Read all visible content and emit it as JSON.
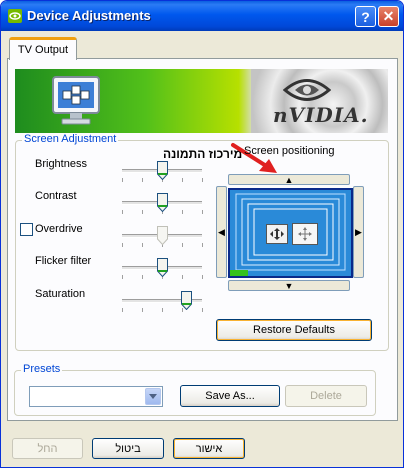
{
  "window": {
    "title": "Device Adjustments",
    "help_button": "?",
    "close_button": "✕"
  },
  "tabs": [
    {
      "label": "TV Output",
      "selected": true
    }
  ],
  "banner": {
    "brand_text": "nVIDIA."
  },
  "screen_adjustment": {
    "group_label": "Screen Adjustment",
    "sliders": [
      {
        "label": "Brightness",
        "level": 0.5,
        "enabled": true
      },
      {
        "label": "Contrast",
        "level": 0.5,
        "enabled": true
      },
      {
        "label": "Overdrive",
        "level": 0.5,
        "enabled": false,
        "has_checkbox": true,
        "checked": false
      },
      {
        "label": "Flicker filter",
        "level": 0.5,
        "enabled": true
      },
      {
        "label": "Saturation",
        "level": 0.8,
        "enabled": true
      }
    ]
  },
  "overlay": {
    "hebrew_note": "מירכוז התמונה",
    "arrow_color": "#e02020"
  },
  "screen_positioning": {
    "label": "Screen positioning",
    "preview_color": "#2a8ad8",
    "restore_defaults": "Restore Defaults"
  },
  "presets": {
    "group_label": "Presets",
    "selected_value": "",
    "save_as": "Save As...",
    "delete": "Delete"
  },
  "footer": {
    "ok": "אישור",
    "cancel": "ביטול",
    "apply": "החל"
  },
  "colors": {
    "title_bar": "#0058ee",
    "group_label": "#0046d5",
    "accent_green": "#52c01a"
  }
}
